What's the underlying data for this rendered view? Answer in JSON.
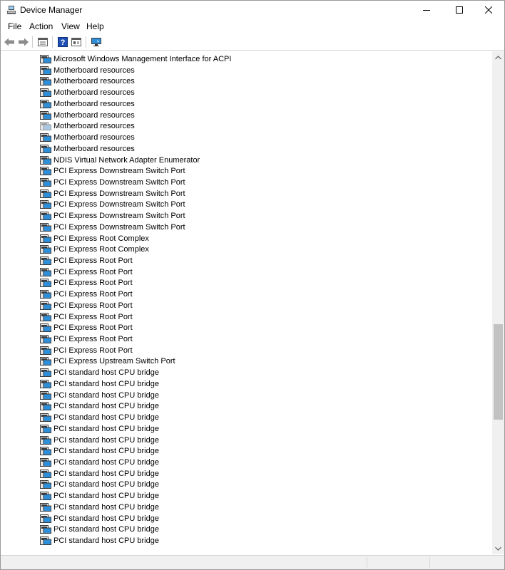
{
  "window": {
    "title": "Device Manager",
    "icon": "device-manager-icon"
  },
  "menu": {
    "items": [
      "File",
      "Action",
      "View",
      "Help"
    ]
  },
  "toolbar": {
    "buttons": [
      "back-arrow-icon",
      "forward-arrow-icon",
      "properties-grid-icon",
      "help-question-icon",
      "show-hidden-icon",
      "scan-monitor-icon"
    ]
  },
  "tree": {
    "items": [
      {
        "label": "Microsoft Windows Management Interface for ACPI",
        "dimmed": false
      },
      {
        "label": "Motherboard resources",
        "dimmed": false
      },
      {
        "label": "Motherboard resources",
        "dimmed": false
      },
      {
        "label": "Motherboard resources",
        "dimmed": false
      },
      {
        "label": "Motherboard resources",
        "dimmed": false
      },
      {
        "label": "Motherboard resources",
        "dimmed": false
      },
      {
        "label": "Motherboard resources",
        "dimmed": true
      },
      {
        "label": "Motherboard resources",
        "dimmed": false
      },
      {
        "label": "Motherboard resources",
        "dimmed": false
      },
      {
        "label": "NDIS Virtual Network Adapter Enumerator",
        "dimmed": false
      },
      {
        "label": "PCI Express Downstream Switch Port",
        "dimmed": false
      },
      {
        "label": "PCI Express Downstream Switch Port",
        "dimmed": false
      },
      {
        "label": "PCI Express Downstream Switch Port",
        "dimmed": false
      },
      {
        "label": "PCI Express Downstream Switch Port",
        "dimmed": false
      },
      {
        "label": "PCI Express Downstream Switch Port",
        "dimmed": false
      },
      {
        "label": "PCI Express Downstream Switch Port",
        "dimmed": false
      },
      {
        "label": "PCI Express Root Complex",
        "dimmed": false
      },
      {
        "label": "PCI Express Root Complex",
        "dimmed": false
      },
      {
        "label": "PCI Express Root Port",
        "dimmed": false
      },
      {
        "label": "PCI Express Root Port",
        "dimmed": false
      },
      {
        "label": "PCI Express Root Port",
        "dimmed": false
      },
      {
        "label": "PCI Express Root Port",
        "dimmed": false
      },
      {
        "label": "PCI Express Root Port",
        "dimmed": false
      },
      {
        "label": "PCI Express Root Port",
        "dimmed": false
      },
      {
        "label": "PCI Express Root Port",
        "dimmed": false
      },
      {
        "label": "PCI Express Root Port",
        "dimmed": false
      },
      {
        "label": "PCI Express Root Port",
        "dimmed": false
      },
      {
        "label": "PCI Express Upstream Switch Port",
        "dimmed": false
      },
      {
        "label": "PCI standard host CPU bridge",
        "dimmed": false
      },
      {
        "label": "PCI standard host CPU bridge",
        "dimmed": false
      },
      {
        "label": "PCI standard host CPU bridge",
        "dimmed": false
      },
      {
        "label": "PCI standard host CPU bridge",
        "dimmed": false
      },
      {
        "label": "PCI standard host CPU bridge",
        "dimmed": false
      },
      {
        "label": "PCI standard host CPU bridge",
        "dimmed": false
      },
      {
        "label": "PCI standard host CPU bridge",
        "dimmed": false
      },
      {
        "label": "PCI standard host CPU bridge",
        "dimmed": false
      },
      {
        "label": "PCI standard host CPU bridge",
        "dimmed": false
      },
      {
        "label": "PCI standard host CPU bridge",
        "dimmed": false
      },
      {
        "label": "PCI standard host CPU bridge",
        "dimmed": false
      },
      {
        "label": "PCI standard host CPU bridge",
        "dimmed": false
      },
      {
        "label": "PCI standard host CPU bridge",
        "dimmed": false
      },
      {
        "label": "PCI standard host CPU bridge",
        "dimmed": false
      },
      {
        "label": "PCI standard host CPU bridge",
        "dimmed": false
      },
      {
        "label": "PCI standard host CPU bridge",
        "dimmed": false
      }
    ]
  },
  "scrollbar": {
    "position": 0.68,
    "visible_fraction": 0.2
  },
  "colors": {
    "icon_blue": "#2e8fd8",
    "icon_dimmed": "#a8c8e4",
    "scroll_thumb": "#c2c2c2"
  }
}
